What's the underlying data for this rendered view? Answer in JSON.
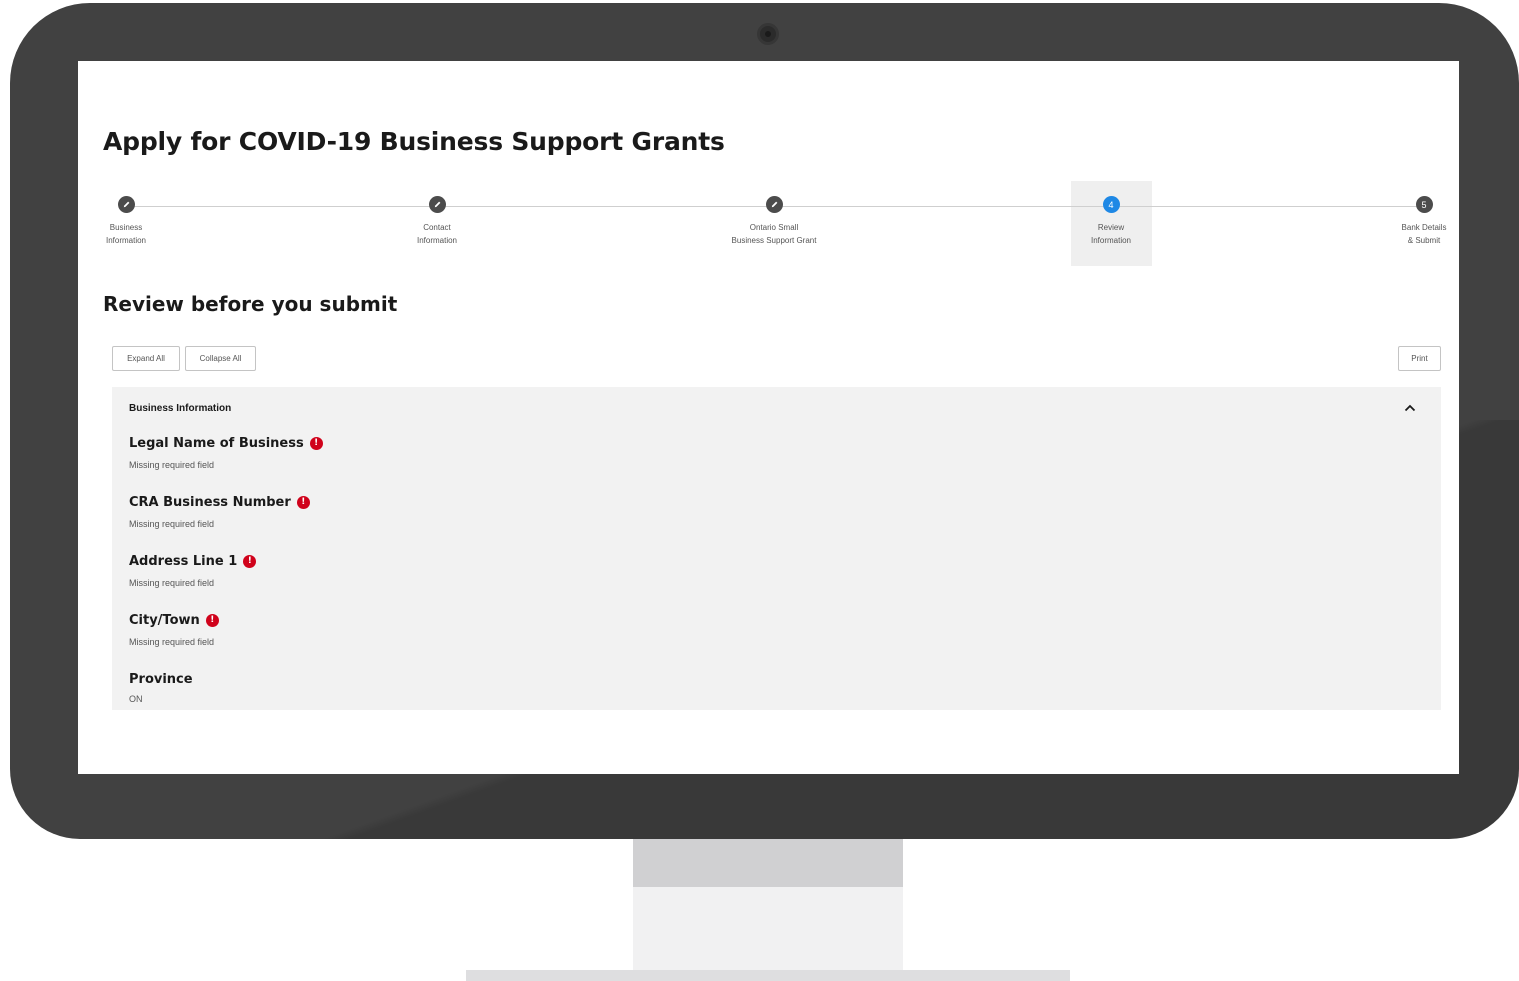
{
  "page": {
    "title": "Apply for COVID-19 Business Support Grants",
    "section_title": "Review before you submit"
  },
  "stepper": {
    "steps": [
      {
        "label": "Business\nInformation",
        "state": "completed",
        "icon": "pencil-icon",
        "number": ""
      },
      {
        "label": "Contact\nInformation",
        "state": "completed",
        "icon": "pencil-icon",
        "number": ""
      },
      {
        "label": "Ontario Small\nBusiness Support Grant",
        "state": "completed",
        "icon": "pencil-icon",
        "number": ""
      },
      {
        "label": "Review\nInformation",
        "state": "active",
        "icon": "",
        "number": "4"
      },
      {
        "label": "Bank Details\n& Submit",
        "state": "upcoming",
        "icon": "",
        "number": "5"
      }
    ]
  },
  "toolbar": {
    "expand_label": "Expand All",
    "collapse_label": "Collapse All",
    "print_label": "Print"
  },
  "panel": {
    "header": "Business Information",
    "chevron_icon": "chevron-up-icon",
    "fields": [
      {
        "label": "Legal Name of Business",
        "error": true,
        "value": "Missing required field"
      },
      {
        "label": "CRA Business Number",
        "error": true,
        "value": "Missing required field"
      },
      {
        "label": "Address Line 1",
        "error": true,
        "value": "Missing required field"
      },
      {
        "label": "City/Town",
        "error": true,
        "value": "Missing required field"
      },
      {
        "label": "Province",
        "error": false,
        "value": "ON"
      }
    ]
  },
  "colors": {
    "active_step": "#1e88e5",
    "error": "#d0021b",
    "bezel": "#414141"
  }
}
